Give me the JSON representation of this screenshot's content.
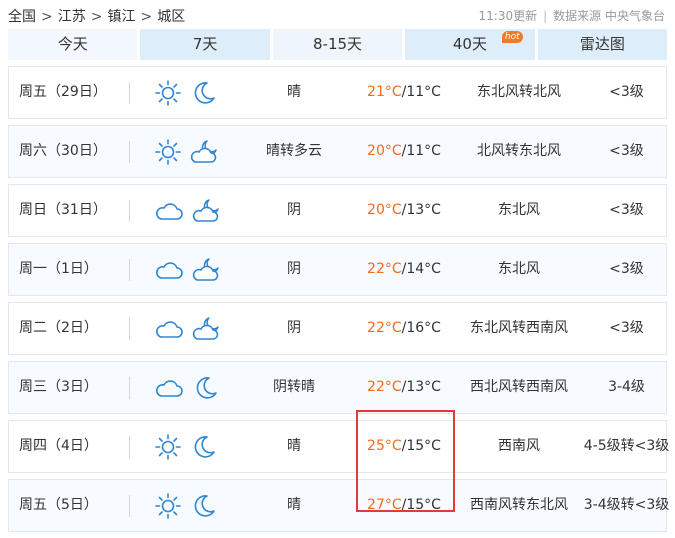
{
  "breadcrumb": {
    "items": [
      "全国",
      "江苏",
      "镇江",
      "城区"
    ],
    "separator": ">"
  },
  "meta": {
    "update_time": "11:30更新",
    "source": "数据来源 中央气象台"
  },
  "tabs": [
    {
      "label": "今天"
    },
    {
      "label": "7天"
    },
    {
      "label": "8-15天"
    },
    {
      "label": "40天",
      "badge": "hot"
    },
    {
      "label": "雷达图"
    }
  ],
  "colors": {
    "high_temp": "#f36b1c",
    "icon_blue": "#2f86d1",
    "highlight": "#e23a3a"
  },
  "forecast": [
    {
      "day": "周五（29日）",
      "icon_day": "sun-icon",
      "icon_night": "moon-icon",
      "desc": "晴",
      "high": "21°C",
      "low": "/11°C",
      "wind": "东北风转北风",
      "level": "<3级"
    },
    {
      "day": "周六（30日）",
      "icon_day": "sun-icon",
      "icon_night": "cloud-moon-icon",
      "desc": "晴转多云",
      "high": "20°C",
      "low": "/11°C",
      "wind": "北风转东北风",
      "level": "<3级"
    },
    {
      "day": "周日（31日）",
      "icon_day": "cloud-icon",
      "icon_night": "cloud-moon-icon",
      "desc": "阴",
      "high": "20°C",
      "low": "/13°C",
      "wind": "东北风",
      "level": "<3级"
    },
    {
      "day": "周一（1日）",
      "icon_day": "cloud-icon",
      "icon_night": "cloud-moon-icon",
      "desc": "阴",
      "high": "22°C",
      "low": "/14°C",
      "wind": "东北风",
      "level": "<3级"
    },
    {
      "day": "周二（2日）",
      "icon_day": "cloud-icon",
      "icon_night": "cloud-moon-icon",
      "desc": "阴",
      "high": "22°C",
      "low": "/16°C",
      "wind": "东北风转西南风",
      "level": "<3级"
    },
    {
      "day": "周三（3日）",
      "icon_day": "cloud-icon",
      "icon_night": "moon-icon",
      "desc": "阴转晴",
      "high": "22°C",
      "low": "/13°C",
      "wind": "西北风转西南风",
      "level": "3-4级"
    },
    {
      "day": "周四（4日）",
      "icon_day": "sun-icon",
      "icon_night": "moon-icon",
      "desc": "晴",
      "high": "25°C",
      "low": "/15°C",
      "wind": "西南风",
      "level": "4-5级转<3级"
    },
    {
      "day": "周五（5日）",
      "icon_day": "sun-icon",
      "icon_night": "moon-icon",
      "desc": "晴",
      "high": "27°C",
      "low": "/15°C",
      "wind": "西南风转东北风",
      "level": "3-4级转<3级"
    }
  ]
}
